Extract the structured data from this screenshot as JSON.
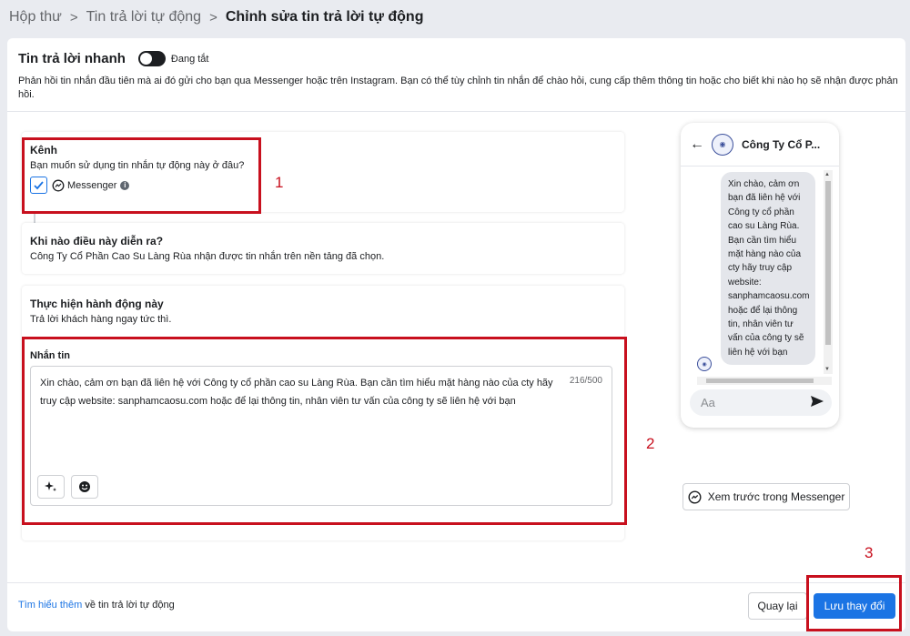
{
  "breadcrumb": {
    "items": [
      "Hộp thư",
      "Tin trả lời tự động"
    ],
    "current": "Chỉnh sửa tin trả lời tự động"
  },
  "quick_reply": {
    "title": "Tin trả lời nhanh",
    "toggle_state": "Đang tắt",
    "description": "Phản hồi tin nhắn đầu tiên mà ai đó gửi cho bạn qua Messenger hoặc trên Instagram. Bạn có thể tùy chỉnh tin nhắn để chào hỏi, cung cấp thêm thông tin hoặc cho biết khi nào họ sẽ nhận được phản hồi."
  },
  "channel": {
    "title": "Kênh",
    "subtitle": "Bạn muốn sử dụng tin nhắn tự động này ở đâu?",
    "option_label": "Messenger",
    "checked": true
  },
  "trigger": {
    "title": "Khi nào điều này diễn ra?",
    "subtitle": "Công Ty Cổ Phần Cao Su Làng Rùa nhận được tin nhắn trên nền tảng đã chọn."
  },
  "action": {
    "title": "Thực hiện hành động này",
    "subtitle": "Trả lời khách hàng ngay tức thì."
  },
  "message": {
    "label": "Nhắn tin",
    "text": "Xin chào, cảm ơn bạn đã liên hệ với Công ty cổ phần cao su Làng Rùa. Bạn cần tìm hiểu mặt hàng nào của cty hãy truy cập website: sanphamcaosu.com hoặc để lại thông tin, nhân viên tư vấn của công ty sẽ liên hệ với bạn",
    "counter": "216/500"
  },
  "preview": {
    "page_name": "Công Ty Cổ P...",
    "bubble_text": "Xin chào, cảm ơn bạn đã liên hệ với Công ty cổ phần cao su Làng Rùa. Bạn cần tìm hiểu mặt hàng nào của cty hãy truy cập website: sanphamcaosu.com hoặc để lại thông tin, nhân viên tư vấn của công ty sẽ liên hệ với bạn",
    "input_placeholder": "Aa",
    "preview_button": "Xem trước trong Messenger"
  },
  "annotations": [
    "1",
    "2",
    "3"
  ],
  "footer": {
    "learn_link": "Tìm hiểu thêm",
    "learn_rest": " về tin trả lời tự động",
    "back_button": "Quay lại",
    "save_button": "Lưu thay đổi"
  },
  "colors": {
    "accent": "#1b74e4",
    "annotation_red": "#c8101e",
    "page_bg": "#e9ebf0"
  },
  "icons": [
    "chevron-right-icon",
    "check-icon",
    "messenger-icon",
    "info-icon",
    "arrow-left-icon",
    "sparkle-icon",
    "emoji-icon",
    "send-icon"
  ]
}
